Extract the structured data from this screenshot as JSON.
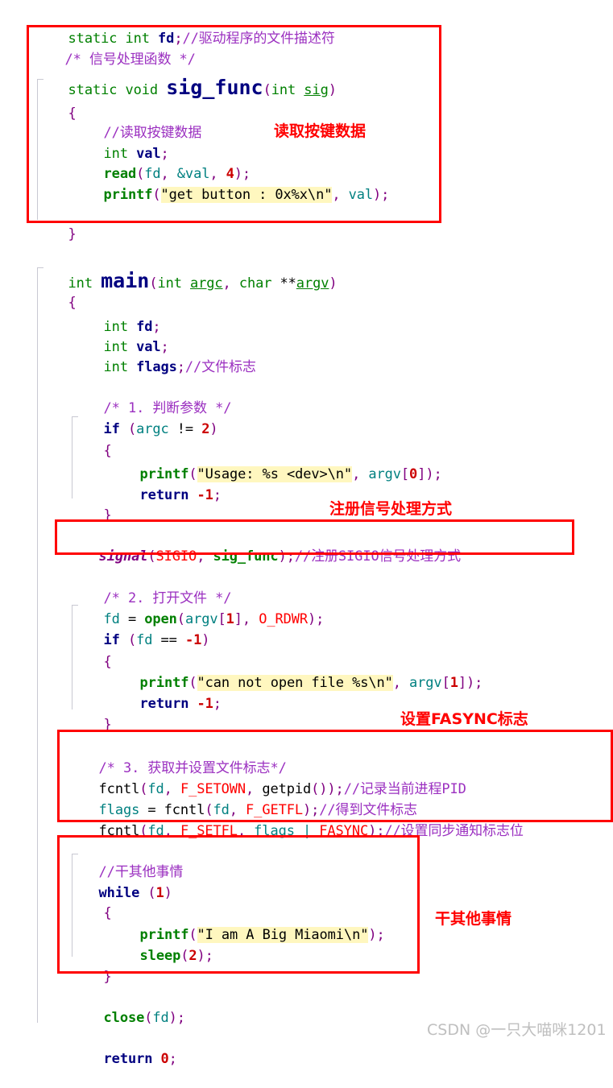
{
  "document": {
    "kind": "source-code-screenshot",
    "language": "C",
    "watermark": "CSDN @一只大喵咪1201"
  },
  "code_lines": [
    {
      "id": "l01",
      "text": "static int fd;//驱动程序的文件描述符"
    },
    {
      "id": "l02",
      "text": "/* 信号处理函数 */"
    },
    {
      "id": "l03",
      "text": "static void sig_func(int sig)"
    },
    {
      "id": "l04",
      "text": "{"
    },
    {
      "id": "l05",
      "text": "    //读取按键数据"
    },
    {
      "id": "l06",
      "text": "    int val;"
    },
    {
      "id": "l07",
      "text": "    read(fd, &val, 4);"
    },
    {
      "id": "l08",
      "text": "    printf(\"get button : 0x%x\\n\", val);"
    },
    {
      "id": "l09",
      "text": "}"
    },
    {
      "id": "l10",
      "text": "int main(int argc, char **argv)"
    },
    {
      "id": "l11",
      "text": "{"
    },
    {
      "id": "l12",
      "text": "    int fd;"
    },
    {
      "id": "l13",
      "text": "    int val;"
    },
    {
      "id": "l14",
      "text": "    int flags;//文件标志"
    },
    {
      "id": "l15",
      "text": "    /* 1. 判断参数 */"
    },
    {
      "id": "l16",
      "text": "    if (argc != 2)"
    },
    {
      "id": "l17",
      "text": "    {"
    },
    {
      "id": "l18",
      "text": "        printf(\"Usage: %s <dev>\\n\", argv[0]);"
    },
    {
      "id": "l19",
      "text": "        return -1;"
    },
    {
      "id": "l20",
      "text": "    }"
    },
    {
      "id": "l21",
      "text": "    signal(SIGIO, sig_func);//注册SIGIO信号处理方式"
    },
    {
      "id": "l22",
      "text": "    /* 2. 打开文件 */"
    },
    {
      "id": "l23",
      "text": "    fd = open(argv[1], O_RDWR);"
    },
    {
      "id": "l24",
      "text": "    if (fd == -1)"
    },
    {
      "id": "l25",
      "text": "    {"
    },
    {
      "id": "l26",
      "text": "        printf(\"can not open file %s\\n\", argv[1]);"
    },
    {
      "id": "l27",
      "text": "        return -1;"
    },
    {
      "id": "l28",
      "text": "    }"
    },
    {
      "id": "l29",
      "text": "    /* 3. 获取并设置文件标志*/"
    },
    {
      "id": "l30",
      "text": "    fcntl(fd, F_SETOWN, getpid());//记录当前进程PID"
    },
    {
      "id": "l31",
      "text": "    flags = fcntl(fd, F_GETFL);//得到文件标志"
    },
    {
      "id": "l32",
      "text": "    fcntl(fd, F_SETFL, flags | FASYNC);//设置同步通知标志位"
    },
    {
      "id": "l33",
      "text": "    //干其他事情"
    },
    {
      "id": "l34",
      "text": "    while (1)"
    },
    {
      "id": "l35",
      "text": "    {"
    },
    {
      "id": "l36",
      "text": "        printf(\"I am A Big Miaomi\\n\");"
    },
    {
      "id": "l37",
      "text": "        sleep(2);"
    },
    {
      "id": "l38",
      "text": "    }"
    },
    {
      "id": "l39",
      "text": "    close(fd);"
    },
    {
      "id": "l40",
      "text": "    return 0;"
    }
  ],
  "tokens": {
    "l01": {
      "k_static": "static",
      "k_int": "int",
      "v_fd": "fd",
      "semi": ";",
      "comment": "//驱动程序的文件描述符"
    },
    "l02": {
      "comment": "/* 信号处理函数 */"
    },
    "l03": {
      "k_static": "static",
      "k_void": "void",
      "name": "sig_func",
      "lp": "(",
      "k_int": "int",
      "param": "sig",
      "rp": ")"
    },
    "l04": {
      "brace": "{"
    },
    "l05": {
      "comment": "//读取按键数据"
    },
    "l06": {
      "k_int": "int",
      "v": "val",
      "semi": ";"
    },
    "l07": {
      "fn": "read",
      "lp": "(",
      "a1": "fd",
      "c1": ",",
      "amp": "&val",
      "c2": ",",
      "num": "4",
      "rp": ")",
      "semi": ";"
    },
    "l08": {
      "fn": "printf",
      "lp": "(",
      "str": "\"get button : 0x%x\\n\"",
      "c1": ",",
      "a2": "val",
      "rp": ")",
      "semi": ";"
    },
    "l09": {
      "brace": "}"
    },
    "l10": {
      "k_int": "int",
      "name": "main",
      "lp": "(",
      "k_int2": "int",
      "p1": "argc",
      "c1": ",",
      "k_char": "char",
      "stars": "**",
      "p2": "argv",
      "rp": ")"
    },
    "l11": {
      "brace": "{"
    },
    "l12": {
      "k_int": "int",
      "v": "fd",
      "semi": ";"
    },
    "l13": {
      "k_int": "int",
      "v": "val",
      "semi": ";"
    },
    "l14": {
      "k_int": "int",
      "v": "flags",
      "semi": ";",
      "comment": "//文件标志"
    },
    "l15": {
      "comment": "/* 1. 判断参数 */"
    },
    "l16": {
      "kw": "if",
      "lp": "(",
      "a": "argc",
      "op": "!=",
      "num": "2",
      "rp": ")"
    },
    "l17": {
      "brace": "{"
    },
    "l18": {
      "fn": "printf",
      "lp": "(",
      "str": "\"Usage: %s <dev>\\n\"",
      "c1": ",",
      "a2": "argv",
      "lb": "[",
      "idx": "0",
      "rb": "]",
      "rp": ")",
      "semi": ";"
    },
    "l19": {
      "kw": "return",
      "num": "-1",
      "semi": ";"
    },
    "l20": {
      "brace": "}"
    },
    "l21": {
      "fn": "signal",
      "lp": "(",
      "m1": "SIGIO",
      "c1": ",",
      "a2": "sig_func",
      "rp": ")",
      "semi": ";",
      "comment": "//注册SIGIO信号处理方式"
    },
    "l22": {
      "comment": "/* 2. 打开文件 */"
    },
    "l23": {
      "v": "fd",
      "eq": "=",
      "fn": "open",
      "lp": "(",
      "a1": "argv",
      "lb": "[",
      "idx": "1",
      "rb": "]",
      "c1": ",",
      "m1": "O_RDWR",
      "rp": ")",
      "semi": ";"
    },
    "l24": {
      "kw": "if",
      "lp": "(",
      "a": "fd",
      "op": "==",
      "num": "-1",
      "rp": ")"
    },
    "l25": {
      "brace": "{"
    },
    "l26": {
      "fn": "printf",
      "lp": "(",
      "str": "\"can not open file %s\\n\"",
      "c1": ",",
      "a2": "argv",
      "lb": "[",
      "idx": "1",
      "rb": "]",
      "rp": ")",
      "semi": ";"
    },
    "l27": {
      "kw": "return",
      "num": "-1",
      "semi": ";"
    },
    "l28": {
      "brace": "}"
    },
    "l29": {
      "comment": "/* 3. 获取并设置文件标志*/"
    },
    "l30": {
      "fn": "fcntl",
      "lp": "(",
      "a1": "fd",
      "c1": ",",
      "m1": "F_SETOWN",
      "c2": ",",
      "fn2": "getpid",
      "lp2": "()",
      "rp": ")",
      "semi": ";",
      "comment": "//记录当前进程PID"
    },
    "l31": {
      "v": "flags",
      "eq": "=",
      "fn": "fcntl",
      "lp": "(",
      "a1": "fd",
      "c1": ",",
      "m1": "F_GETFL",
      "rp": ")",
      "semi": ";",
      "comment": "//得到文件标志"
    },
    "l32": {
      "fn": "fcntl",
      "lp": "(",
      "a1": "fd",
      "c1": ",",
      "m1": "F_SETFL",
      "c2": ",",
      "a2": "flags",
      "pipe": "|",
      "m2": "FASYNC",
      "rp": ")",
      "semi": ";",
      "comment": "//设置同步通知标志位"
    },
    "l33": {
      "comment": "//干其他事情"
    },
    "l34": {
      "kw": "while",
      "lp": "(",
      "num": "1",
      "rp": ")"
    },
    "l35": {
      "brace": "{"
    },
    "l36": {
      "fn": "printf",
      "lp": "(",
      "str": "\"I am A Big Miaomi\\n\"",
      "rp": ")",
      "semi": ";"
    },
    "l37": {
      "fn": "sleep",
      "lp": "(",
      "num": "2",
      "rp": ")",
      "semi": ";"
    },
    "l38": {
      "brace": "}"
    },
    "l39": {
      "fn": "close",
      "lp": "(",
      "a1": "fd",
      "rp": ")",
      "semi": ";"
    },
    "l40": {
      "kw": "return",
      "num": "0",
      "semi": ";"
    }
  },
  "annotations": [
    {
      "id": "a1",
      "label": "读取按键数据"
    },
    {
      "id": "a2",
      "label": "注册信号处理方式"
    },
    {
      "id": "a3",
      "label": "设置FASYNC标志"
    },
    {
      "id": "a4",
      "label": "干其他事情"
    }
  ],
  "highlight_boxes": [
    {
      "id": "box-sig-func",
      "note": "signal handler function"
    },
    {
      "id": "box-signal-register",
      "note": "signal registration line"
    },
    {
      "id": "box-fcntl-flags",
      "note": "fcntl flag setup"
    },
    {
      "id": "box-while-loop",
      "note": "busy work while loop"
    }
  ],
  "colors": {
    "box_border": "#ff0000",
    "annotation": "#ff0000",
    "comment": "#9b30c0",
    "keyword": "#008000",
    "function": "#008000",
    "macro": "#ff0000",
    "number": "#cc0000",
    "string_bg": "#fff7bf",
    "identifier": "#000080",
    "variable": "#008080",
    "punctuation": "#800080",
    "watermark": "#bfbfbf",
    "background": "#ffffff"
  }
}
